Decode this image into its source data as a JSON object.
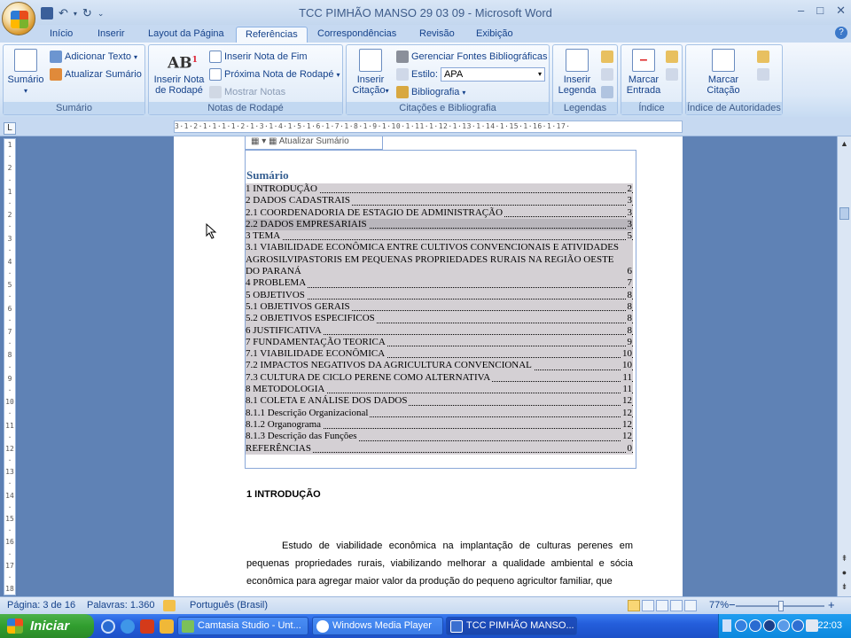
{
  "window": {
    "title": "TCC PIMHÃO MANSO  29 03 09 - Microsoft Word",
    "controls": [
      "–",
      "□",
      "✕"
    ]
  },
  "ribbon_tabs": [
    "Início",
    "Inserir",
    "Layout da Página",
    "Referências",
    "Correspondências",
    "Revisão",
    "Exibição"
  ],
  "active_tab": "Referências",
  "ribbon": {
    "sumario_group": {
      "label": "Sumário",
      "big_button": "Sumário",
      "adicionar_texto": "Adicionar Texto",
      "atualizar_sumario": "Atualizar Sumário"
    },
    "notas_group": {
      "label": "Notas de Rodapé",
      "inserir_nota_line1": "Inserir Nota",
      "inserir_nota_line2": "de Rodapé",
      "inserir_nota_fim": "Inserir Nota de Fim",
      "proxima_nota": "Próxima Nota de Rodapé",
      "mostrar_notas": "Mostrar Notas"
    },
    "citacoes_group": {
      "label": "Citações e Bibliografia",
      "inserir_citacao_line1": "Inserir",
      "inserir_citacao_line2": "Citação",
      "gerenciar_fontes": "Gerenciar Fontes Bibliográficas",
      "estilo_label": "Estilo:",
      "estilo_value": "APA",
      "bibliografia": "Bibliografia"
    },
    "legendas_group": {
      "label": "Legendas",
      "inserir_legenda_line1": "Inserir",
      "inserir_legenda_line2": "Legenda"
    },
    "indice_group": {
      "label": "Índice",
      "marcar_entrada_line1": "Marcar",
      "marcar_entrada_line2": "Entrada"
    },
    "autoridades_group": {
      "label": "Índice de Autoridades",
      "marcar_citacao_line1": "Marcar",
      "marcar_citacao_line2": "Citação"
    }
  },
  "ruler": {
    "horizontal": "3·1·2·1·1·1·1·2·1·3·1·4·1·5·1·6·1·7·1·8·1·9·1·10·1·11·1·12·1·13·1·14·1·15·1·16·1·17·",
    "vertical": [
      "1",
      "2",
      "1",
      "2",
      "3",
      "4",
      "5",
      "6",
      "7",
      "8",
      "9",
      "10",
      "11",
      "12",
      "13",
      "14",
      "15",
      "16",
      "17",
      "18",
      "19"
    ]
  },
  "document": {
    "toc_tab_label": "Atualizar Sumário",
    "toc_title": "Sumário",
    "toc_entries": [
      {
        "text": "1 INTRODUÇÃO",
        "page": "2"
      },
      {
        "text": "2 DADOS CADASTRAIS",
        "page": "3"
      },
      {
        "text": "2.1 COORDENADORIA DE ESTAGIO DE ADMINISTRAÇÃO",
        "page": "3"
      },
      {
        "text": "2.2 DADOS EMPRESARIAIS",
        "page": "3"
      },
      {
        "text": "3 TEMA",
        "page": "5"
      },
      {
        "text": "3.1 VIABILIDADE ECONÔMICA ENTRE CULTIVOS CONVENCIONAIS E ATIVIDADES AGROSILVIPASTORIS EM PEQUENAS PROPRIEDADES RURAIS NA REGIÃO OESTE DO PARANÁ",
        "page": "6"
      },
      {
        "text": "4 PROBLEMA",
        "page": "7"
      },
      {
        "text": "5 OBJETIVOS",
        "page": "8"
      },
      {
        "text": "5.1 OBJETIVOS GERAIS",
        "page": "8"
      },
      {
        "text": "5.2 OBJETIVOS ESPECIFICOS",
        "page": "8"
      },
      {
        "text": "6  JUSTIFICATIVA",
        "page": "8"
      },
      {
        "text": "7  FUNDAMENTAÇÃO TEORICA",
        "page": "9"
      },
      {
        "text": "7.1 VIABILIDADE ECONÔMICA",
        "page": "10"
      },
      {
        "text": "7.2 IMPACTOS NEGATIVOS DA AGRICULTURA CONVENCIONAL",
        "page": "10"
      },
      {
        "text": "7.3 CULTURA DE CICLO PERENE COMO ALTERNATIVA",
        "page": "11"
      },
      {
        "text": "8 METODOLOGIA",
        "page": "11"
      },
      {
        "text": "8.1 COLETA E ANÁLISE DOS DADOS",
        "page": "12"
      },
      {
        "text": "8.1.1 Descrição Organizacional",
        "page": "12"
      },
      {
        "text": "8.1.2 Organograma",
        "page": "12"
      },
      {
        "text": "8.1.3 Descrição das Funções",
        "page": "12"
      },
      {
        "text": "REFERÊNCIAS",
        "page": "0"
      }
    ],
    "heading": "1 INTRODUÇÃO",
    "body": "Estudo de viabilidade econômica na implantação de culturas perenes em pequenas propriedades rurais, viabilizando melhorar a qualidade ambiental e sócia econômica para agregar maior valor da produção do pequeno agricultor familiar, que"
  },
  "statusbar": {
    "page": "Página: 3 de 16",
    "words": "Palavras: 1.360",
    "language": "Português (Brasil)",
    "zoom": "77%",
    "zoom_level": 0.77
  },
  "taskbar": {
    "start": "Iniciar",
    "buttons": [
      "Camtasia Studio - Unt...",
      "Windows Media Player",
      "TCC PIMHÃO MANSO..."
    ],
    "clock": "22:03"
  }
}
